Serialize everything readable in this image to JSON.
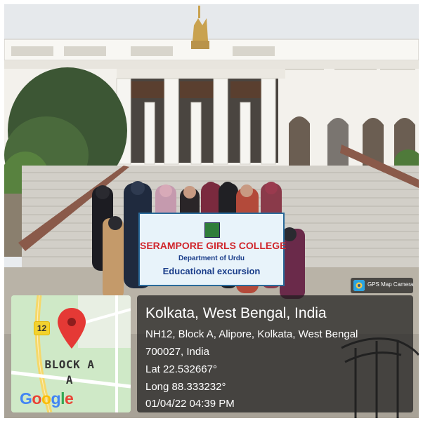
{
  "photo": {
    "description_kind": "group photo in front of colonnaded white building with staircase",
    "banner": {
      "title": "SERAMPORE GIRLS COLLEGE",
      "department": "Department of Urdu",
      "subtitle": "Educational excursion"
    },
    "building_emblem": "emblem-icon"
  },
  "map": {
    "road_number": "12",
    "block_label_line1": "BLOCK A",
    "block_label_line2": "A",
    "logo_text": [
      "G",
      "o",
      "o",
      "g",
      "l",
      "e"
    ],
    "logo_colors": [
      "#4285F4",
      "#EA4335",
      "#FBBC05",
      "#4285F4",
      "#34A853",
      "#EA4335"
    ],
    "pin_color": "#E53935",
    "pin_icon": "map-pin-icon"
  },
  "gps_badge": {
    "label": "GPS Map Camera",
    "icon": "gps-camera-icon"
  },
  "location": {
    "title": "Kolkata, West Bengal, India",
    "address_line1": "NH12, Block A, Alipore, Kolkata, West Bengal",
    "address_line2": "700027, India",
    "latitude": "Lat 22.532667°",
    "longitude": "Long 88.333232°",
    "timestamp": "01/04/22 04:39 PM"
  }
}
